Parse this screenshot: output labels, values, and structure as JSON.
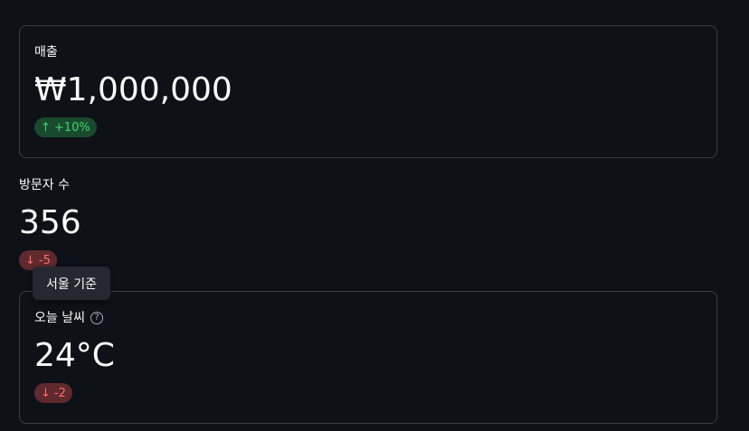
{
  "metrics": [
    {
      "label": "매출",
      "value": "₩1,000,000",
      "delta": "+10%",
      "delta_direction": "up"
    },
    {
      "label": "방문자 수",
      "value": "356",
      "delta": "-5",
      "delta_direction": "down"
    },
    {
      "label": "오늘 날씨",
      "value": "24°C",
      "delta": "-2",
      "delta_direction": "down",
      "help_icon": "question-circle-icon"
    }
  ],
  "tooltip": {
    "text": "서울 기준"
  },
  "colors": {
    "background": "#0e1117",
    "border": "#3a3c44",
    "delta_up_bg": "#1a4a2e",
    "delta_up_fg": "#3dd56d",
    "delta_down_bg": "#5e2a2e",
    "delta_down_fg": "#ff6c6c",
    "tooltip_bg": "#262730"
  }
}
